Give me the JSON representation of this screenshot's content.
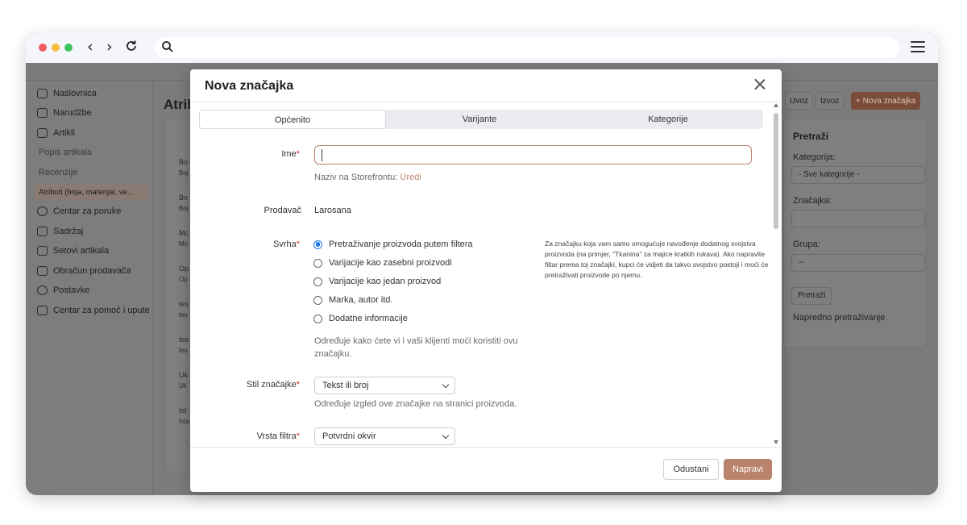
{
  "browser": {
    "address_value": ""
  },
  "sidebar": {
    "items": [
      {
        "label": "Naslovnica"
      },
      {
        "label": "Narudžbe"
      },
      {
        "label": "Artikli"
      },
      {
        "label": "Popis artikala"
      },
      {
        "label": "Recenzije"
      },
      {
        "label": "Atributi (boja, materijal, ve..."
      },
      {
        "label": "Centar za poruke"
      },
      {
        "label": "Sadržaj"
      },
      {
        "label": "Setovi artikala"
      },
      {
        "label": "Obračun prodavača"
      },
      {
        "label": "Postavke"
      },
      {
        "label": "Centar za pomoć i upute"
      }
    ]
  },
  "background": {
    "page_title": "Atrib",
    "row_labels": [
      "Bo",
      "Boj",
      "Bo",
      "Boj",
      "Mc",
      "Mo",
      "Op",
      "Op",
      "tes",
      "tes",
      "tes",
      "tes",
      "Uk",
      "Uk",
      "Ist",
      "Ista"
    ],
    "toolbar": {
      "import": "Uvoz",
      "export": "Izvoz",
      "new_feature": "+ Nova značajka"
    },
    "search_panel": {
      "heading": "Pretraži",
      "category_label": "Kategorija:",
      "category_value": "- Sve kategorije -",
      "feature_label": "Značajka:",
      "group_label": "Grupa:",
      "group_value": "--",
      "search_button": "Pretraži",
      "advanced_search": "Napredno pretraživanje"
    }
  },
  "modal": {
    "title": "Nova značajka",
    "tabs": [
      {
        "label": "Općenito",
        "active": true
      },
      {
        "label": "Varijante",
        "active": false
      },
      {
        "label": "Kategorije",
        "active": false
      }
    ],
    "name": {
      "label": "Ime",
      "required_mark": "*",
      "value": "",
      "help_prefix": "Naziv na Storefrontu:",
      "help_link": "Uredi"
    },
    "vendor": {
      "label": "Prodavač",
      "value": "Larosana"
    },
    "purpose": {
      "label": "Svrha",
      "required_mark": "*",
      "options": [
        {
          "label": "Pretraživanje proizvoda putem filtera",
          "selected": true
        },
        {
          "label": "Varijacije kao zasebni proizvodi",
          "selected": false
        },
        {
          "label": "Varijacije kao jedan proizvod",
          "selected": false
        },
        {
          "label": "Marka, autor itd.",
          "selected": false
        },
        {
          "label": "Dodatne informacije",
          "selected": false
        }
      ],
      "help": "Određuje kako ćete vi i vaši klijenti moći koristiti ovu značajku.",
      "note": "Za značajku koja vam samo omogućuje navođenje dodatnog svojstva proizvoda (na primjer, \"Tkanina\" za majice kratkih rukava). Ako napravite filtar prema toj značajki, kupci će vidjeti da takvo svojstvo postoji i moći će pretraživati proizvode po njemu."
    },
    "feature_style": {
      "label": "Stil značajke",
      "required_mark": "*",
      "value": "Tekst ili broj",
      "help": "Određuje izgled ove značajke na stranici proizvoda."
    },
    "filter_type": {
      "label": "Vrsta filtra",
      "required_mark": "*",
      "value": "Potvrdni okvir"
    },
    "buttons": {
      "cancel": "Odustani",
      "create": "Napravi"
    }
  }
}
